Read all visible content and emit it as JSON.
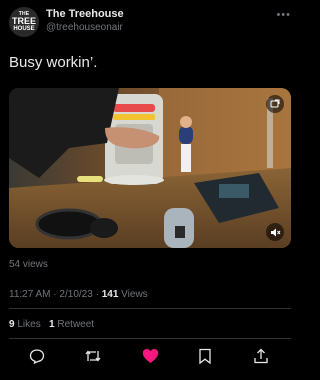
{
  "author": {
    "avatar_text_top": "THE",
    "avatar_text_mid": "TREE",
    "avatar_text_bottom": "HOUSE",
    "display_name": "The Treehouse",
    "handle": "@treehouseonair"
  },
  "more_icon": "more-dots-icon",
  "tweet": {
    "text": "Busy workin’.",
    "views_label": "54 views",
    "time": "11:27 AM",
    "date": "2/10/23",
    "view_count": "141",
    "view_count_label": "Views",
    "likes_count": "9",
    "likes_label": "Likes",
    "retweets_count": "1",
    "retweets_label": "Retweet"
  },
  "media": {
    "type": "video",
    "top_icon": "edit-icon",
    "bottom_icon": "mute-icon"
  },
  "actions": [
    {
      "name": "reply",
      "icon": "reply-icon"
    },
    {
      "name": "retweet",
      "icon": "retweet-icon"
    },
    {
      "name": "like",
      "icon": "heart-icon",
      "active": true,
      "color": "#f91880"
    },
    {
      "name": "bookmark",
      "icon": "bookmark-icon"
    },
    {
      "name": "share",
      "icon": "share-icon"
    }
  ],
  "colors": {
    "background": "#000000",
    "primary_text": "#e7e9ea",
    "secondary_text": "#71767b",
    "like_active": "#f91880"
  }
}
